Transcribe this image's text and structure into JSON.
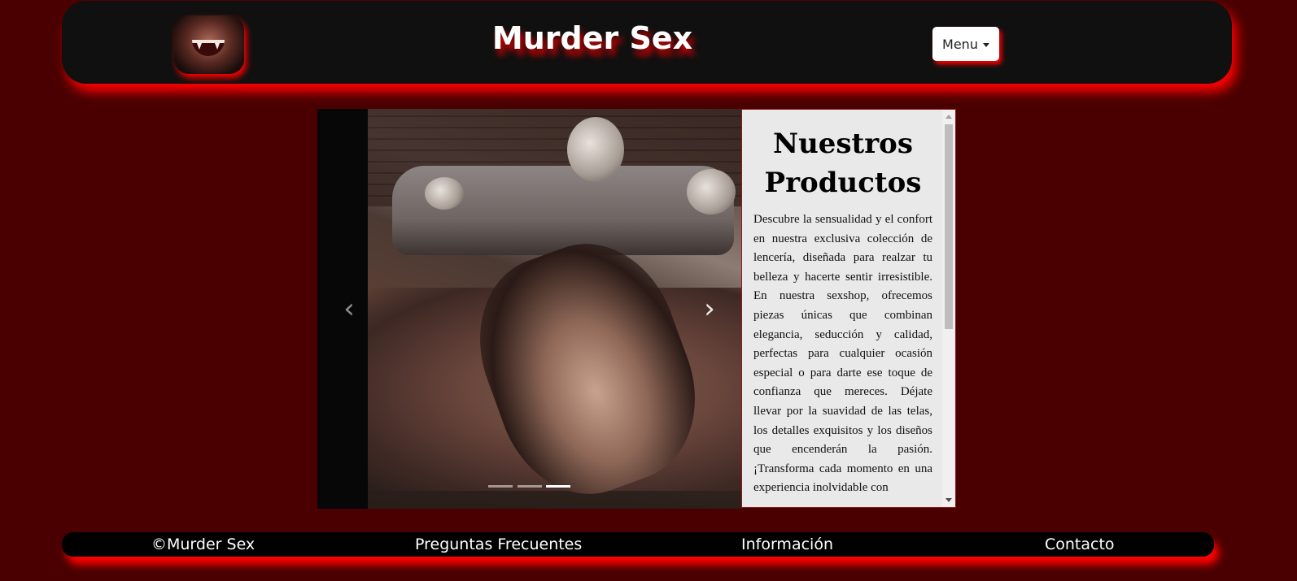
{
  "header": {
    "title": "Murder Sex",
    "menu_label": "Menu"
  },
  "carousel": {
    "prev_icon": "chevron-left-icon",
    "next_icon": "chevron-right-icon",
    "prev_glyph": "‹",
    "next_glyph": "›",
    "slide_count": 3,
    "active_slide": 3
  },
  "products": {
    "title": "Nuestros Productos",
    "description": "Descubre la sensualidad y el confort en nuestra exclusiva colección de lencería, diseñada para realzar tu belleza y hacerte sentir irresistible. En nuestra sexshop, ofrecemos piezas únicas que combinan elegancia, seducción y calidad, perfectas para cualquier ocasión especial o para darte ese toque de confianza que mereces. Déjate llevar por la suavidad de las telas, los detalles exquisitos y los diseños que encenderán la pasión. ¡Transforma cada momento en una experiencia inolvidable con"
  },
  "footer": {
    "copyright": "©Murder Sex",
    "faq": "Preguntas Frecuentes",
    "info": "Información",
    "contact": "Contacto"
  },
  "colors": {
    "background": "#4a0000",
    "glow": "#ff0000",
    "header_bg": "#101010",
    "panel_bg": "#e9e9e9"
  }
}
